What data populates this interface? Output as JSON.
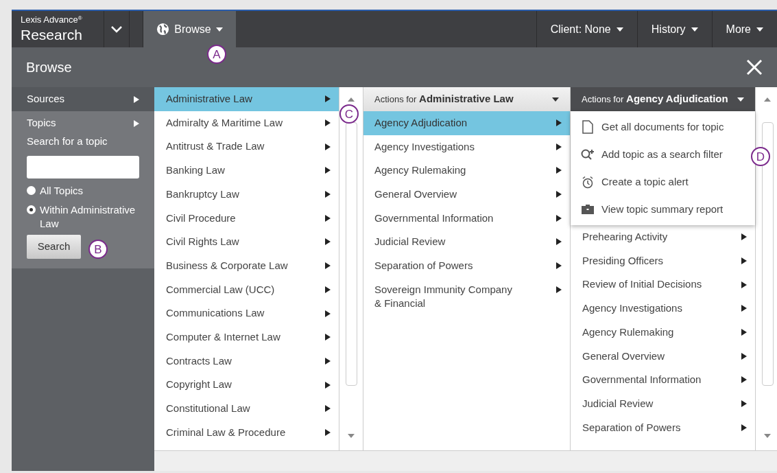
{
  "top_nav": {
    "brand_small": "Lexis Advance",
    "brand_mark": "®",
    "brand": "Research",
    "browse": "Browse",
    "right_menus": [
      "Client: None",
      "History",
      "More"
    ]
  },
  "browse_header": {
    "title": "Browse"
  },
  "left_panel": {
    "items": [
      {
        "label": "Sources",
        "selected": false
      },
      {
        "label": "Topics",
        "selected": true
      }
    ],
    "search_label": "Search for a topic",
    "radios": [
      {
        "label": "All Topics",
        "selected": false
      },
      {
        "label": "Within Administrative Law",
        "selected": true
      }
    ],
    "search_button": "Search"
  },
  "topics": [
    {
      "label": "Administrative Law",
      "selected": true
    },
    {
      "label": "Admiralty & Maritime Law",
      "selected": false
    },
    {
      "label": "Antitrust & Trade Law",
      "selected": false
    },
    {
      "label": "Banking Law",
      "selected": false
    },
    {
      "label": "Bankruptcy Law",
      "selected": false
    },
    {
      "label": "Civil Procedure",
      "selected": false
    },
    {
      "label": "Civil Rights Law",
      "selected": false
    },
    {
      "label": "Business & Corporate Law",
      "selected": false
    },
    {
      "label": "Commercial Law (UCC)",
      "selected": false
    },
    {
      "label": "Communications Law",
      "selected": false
    },
    {
      "label": "Computer & Internet Law",
      "selected": false
    },
    {
      "label": "Contracts Law",
      "selected": false
    },
    {
      "label": "Copyright Law",
      "selected": false
    },
    {
      "label": "Constitutional Law",
      "selected": false
    },
    {
      "label": "Criminal Law & Procedure",
      "selected": false
    }
  ],
  "subtopics": {
    "header_prefix": "Actions for",
    "header_topic": "Administrative Law",
    "items": [
      {
        "label": "Agency Adjudication",
        "selected": true
      },
      {
        "label": "Agency Investigations",
        "selected": false
      },
      {
        "label": "Agency Rulemaking",
        "selected": false
      },
      {
        "label": "General Overview",
        "selected": false
      },
      {
        "label": "Governmental Information",
        "selected": false
      },
      {
        "label": "Judicial Review",
        "selected": false
      },
      {
        "label": "Separation of Powers",
        "selected": false
      },
      {
        "label": "Sovereign Immunity Company & Financial",
        "selected": false
      }
    ]
  },
  "subsubtopics": {
    "header_prefix": "Actions for",
    "header_topic": "Agency Adjudication",
    "actions": [
      {
        "kind": "document",
        "label": "Get all documents for topic"
      },
      {
        "kind": "filter",
        "label": "Add topic as a search filter"
      },
      {
        "kind": "alert",
        "label": "Create a topic alert"
      },
      {
        "kind": "report",
        "label": "View topic summary report"
      }
    ],
    "items": [
      {
        "label": "Prehearing Activity",
        "selected": false
      },
      {
        "label": "Presiding Officers",
        "selected": false
      },
      {
        "label": "Review of Initial Decisions",
        "selected": false
      },
      {
        "label": "Agency Investigations",
        "selected": false
      },
      {
        "label": "Agency Rulemaking",
        "selected": false
      },
      {
        "label": "General Overview",
        "selected": false
      },
      {
        "label": "Governmental Information",
        "selected": false
      },
      {
        "label": "Judicial Review",
        "selected": false
      },
      {
        "label": "Separation of Powers",
        "selected": false
      }
    ]
  },
  "callouts": [
    "A",
    "B",
    "C",
    "D"
  ]
}
